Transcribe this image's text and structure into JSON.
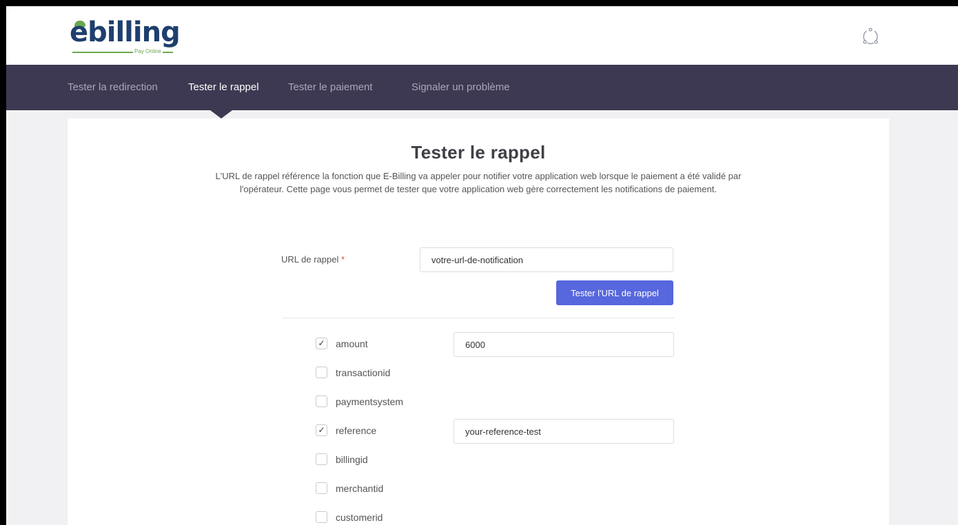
{
  "header": {
    "logo_text": "ebilling",
    "logo_subtitle": "Pay Online",
    "user_icon": "user-circle-icon"
  },
  "nav": {
    "items": [
      {
        "label": "Tester la redirection",
        "active": false
      },
      {
        "label": "Tester le rappel",
        "active": true
      },
      {
        "label": "Tester le paiement",
        "active": false
      },
      {
        "label": "Signaler un problème",
        "active": false
      }
    ]
  },
  "main": {
    "title": "Tester le rappel",
    "description": "L'URL de rappel référence la fonction que E-Billing va appeler pour notifier votre application web lorsque le paiement a été validé par l'opérateur. Cette page vous permet de tester que votre application web gère correctement les notifications de paiement.",
    "url_field": {
      "label": "URL de rappel",
      "required_mark": "*",
      "value": "votre-url-de-notification"
    },
    "test_button": "Tester l'URL de rappel",
    "params": [
      {
        "name": "amount",
        "checked": true,
        "value": "6000"
      },
      {
        "name": "transactionid",
        "checked": false
      },
      {
        "name": "paymentsystem",
        "checked": false
      },
      {
        "name": "reference",
        "checked": true,
        "value": "your-reference-test"
      },
      {
        "name": "billingid",
        "checked": false
      },
      {
        "name": "merchantid",
        "checked": false
      },
      {
        "name": "customerid",
        "checked": false
      }
    ],
    "checkmark": "✓"
  },
  "colors": {
    "nav_bg": "#3d3952",
    "accent": "#5767dd",
    "logo_blue": "#1e3f6e",
    "logo_green": "#6aa84f"
  }
}
